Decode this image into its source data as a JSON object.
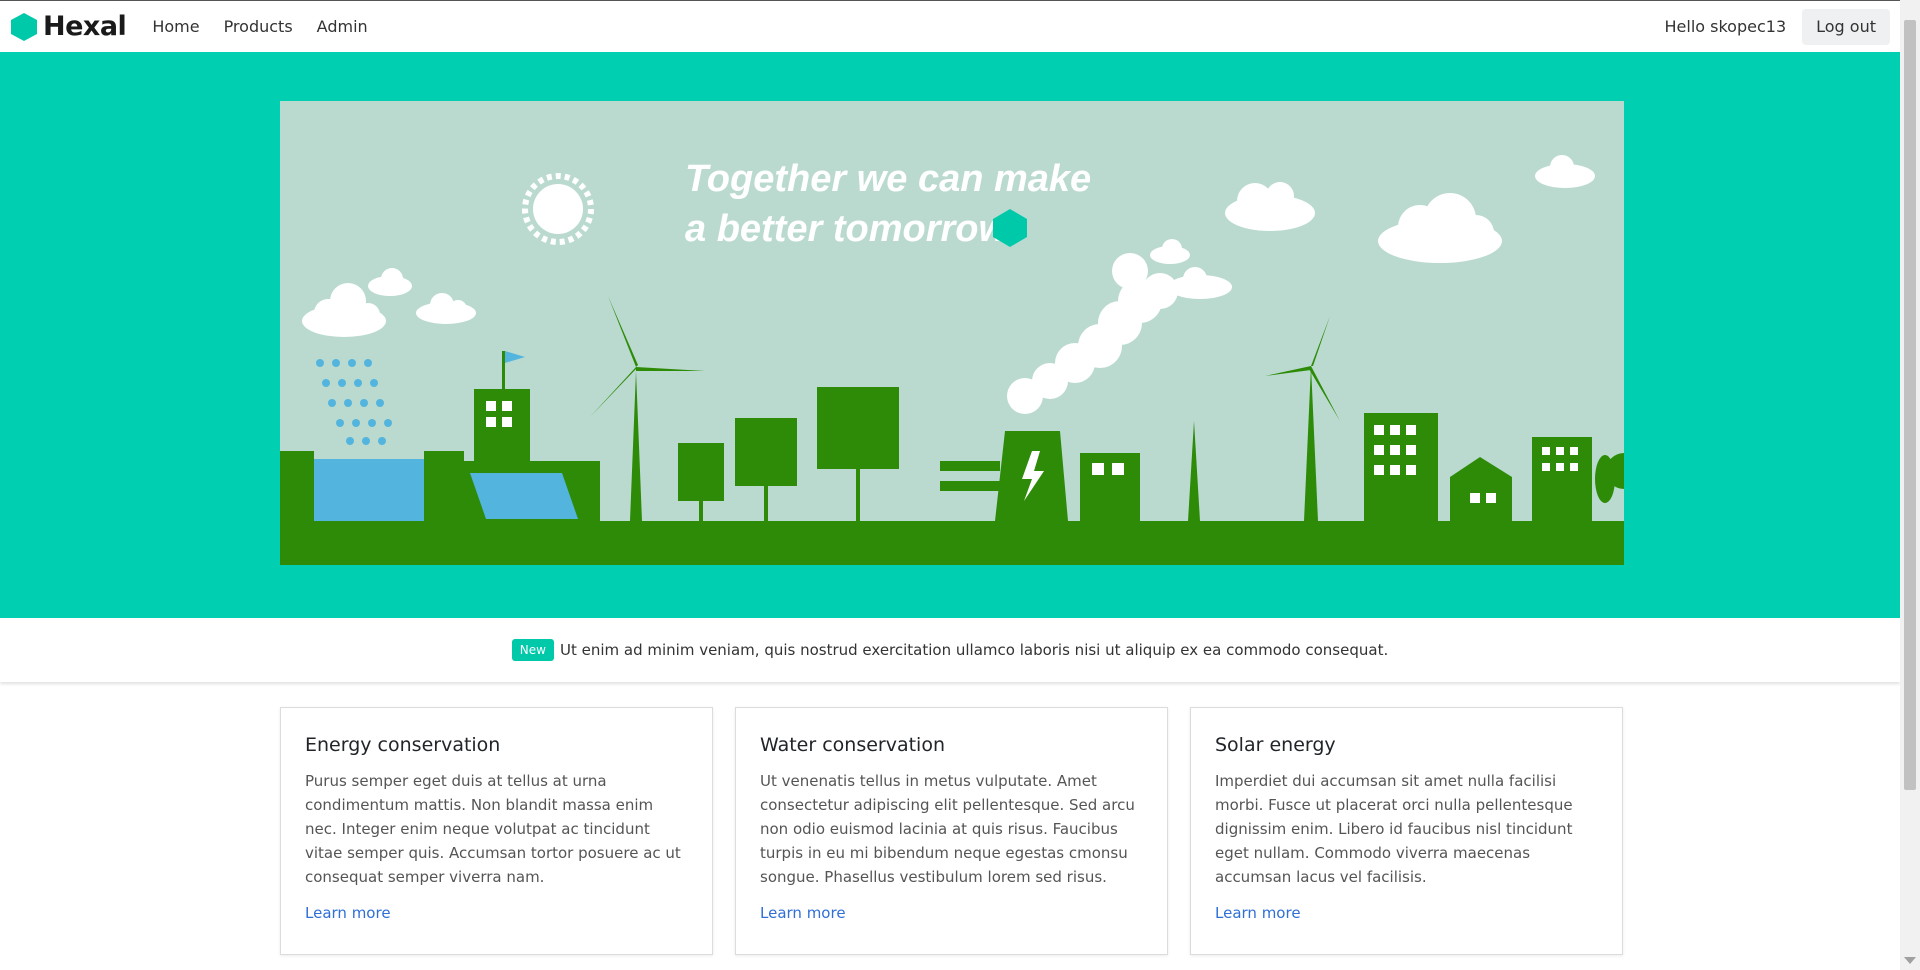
{
  "brand": {
    "name": "Hexal",
    "accent": "#00c9aa"
  },
  "nav": {
    "links": [
      {
        "label": "Home"
      },
      {
        "label": "Products"
      },
      {
        "label": "Admin"
      }
    ],
    "greeting": "Hello skopec13",
    "logout_label": "Log out"
  },
  "hero": {
    "background": "#01cfb2",
    "headline_line1": "Together we can make",
    "headline_line2": "a better tomorrow"
  },
  "announcement": {
    "badge": "New",
    "text": "Ut enim ad minim veniam, quis nostrud exercitation ullamco laboris nisi ut aliquip ex ea commodo consequat."
  },
  "cards": [
    {
      "title": "Energy conservation",
      "text": "Purus semper eget duis at tellus at urna condimentum mattis. Non blandit massa enim nec. Integer enim neque volutpat ac tincidunt vitae semper quis. Accumsan tortor posuere ac ut consequat semper viverra nam.",
      "link": "Learn more"
    },
    {
      "title": "Water conservation",
      "text": "Ut venenatis tellus in metus vulputate. Amet consectetur adipiscing elit pellentesque. Sed arcu non odio euismod lacinia at quis risus. Faucibus turpis in eu mi bibendum neque egestas cmonsu songue. Phasellus vestibulum lorem sed risus.",
      "link": "Learn more"
    },
    {
      "title": "Solar energy",
      "text": "Imperdiet dui accumsan sit amet nulla facilisi morbi. Fusce ut placerat orci nulla pellentesque dignissim enim. Libero id faucibus nisl tincidunt eget nullam. Commodo viverra maecenas accumsan lacus vel facilisis.",
      "link": "Learn more"
    }
  ]
}
